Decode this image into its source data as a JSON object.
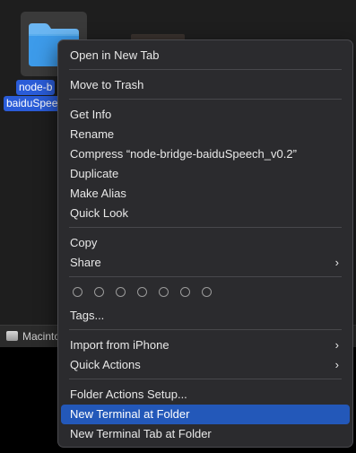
{
  "desktop": {
    "file_label_line1": "node-b",
    "file_label_line2": "baiduSpee",
    "path_label": "Macinto"
  },
  "menu": {
    "open_in_new_tab": "Open in New Tab",
    "move_to_trash": "Move to Trash",
    "get_info": "Get Info",
    "rename": "Rename",
    "compress": "Compress “node-bridge-baiduSpeech_v0.2”",
    "duplicate": "Duplicate",
    "make_alias": "Make Alias",
    "quick_look": "Quick Look",
    "copy": "Copy",
    "share": "Share",
    "tags": "Tags...",
    "import_from_iphone": "Import from iPhone",
    "quick_actions": "Quick Actions",
    "folder_actions_setup": "Folder Actions Setup...",
    "new_terminal_at_folder": "New Terminal at Folder",
    "new_terminal_tab_at_folder": "New Terminal Tab at Folder"
  },
  "colors": {
    "highlight": "#2358b9",
    "menu_bg": "#2b2b2e",
    "folder_blue": "#3d9bea"
  }
}
